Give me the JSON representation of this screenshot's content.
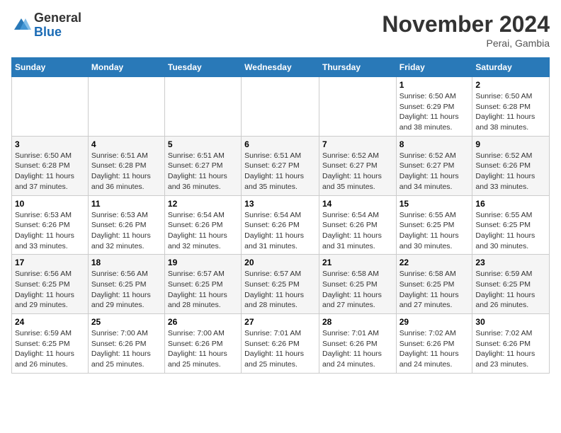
{
  "logo": {
    "general": "General",
    "blue": "Blue"
  },
  "title": "November 2024",
  "location": "Perai, Gambia",
  "days_of_week": [
    "Sunday",
    "Monday",
    "Tuesday",
    "Wednesday",
    "Thursday",
    "Friday",
    "Saturday"
  ],
  "weeks": [
    [
      {
        "day": "",
        "info": ""
      },
      {
        "day": "",
        "info": ""
      },
      {
        "day": "",
        "info": ""
      },
      {
        "day": "",
        "info": ""
      },
      {
        "day": "",
        "info": ""
      },
      {
        "day": "1",
        "info": "Sunrise: 6:50 AM\nSunset: 6:29 PM\nDaylight: 11 hours and 38 minutes."
      },
      {
        "day": "2",
        "info": "Sunrise: 6:50 AM\nSunset: 6:28 PM\nDaylight: 11 hours and 38 minutes."
      }
    ],
    [
      {
        "day": "3",
        "info": "Sunrise: 6:50 AM\nSunset: 6:28 PM\nDaylight: 11 hours and 37 minutes."
      },
      {
        "day": "4",
        "info": "Sunrise: 6:51 AM\nSunset: 6:28 PM\nDaylight: 11 hours and 36 minutes."
      },
      {
        "day": "5",
        "info": "Sunrise: 6:51 AM\nSunset: 6:27 PM\nDaylight: 11 hours and 36 minutes."
      },
      {
        "day": "6",
        "info": "Sunrise: 6:51 AM\nSunset: 6:27 PM\nDaylight: 11 hours and 35 minutes."
      },
      {
        "day": "7",
        "info": "Sunrise: 6:52 AM\nSunset: 6:27 PM\nDaylight: 11 hours and 35 minutes."
      },
      {
        "day": "8",
        "info": "Sunrise: 6:52 AM\nSunset: 6:27 PM\nDaylight: 11 hours and 34 minutes."
      },
      {
        "day": "9",
        "info": "Sunrise: 6:52 AM\nSunset: 6:26 PM\nDaylight: 11 hours and 33 minutes."
      }
    ],
    [
      {
        "day": "10",
        "info": "Sunrise: 6:53 AM\nSunset: 6:26 PM\nDaylight: 11 hours and 33 minutes."
      },
      {
        "day": "11",
        "info": "Sunrise: 6:53 AM\nSunset: 6:26 PM\nDaylight: 11 hours and 32 minutes."
      },
      {
        "day": "12",
        "info": "Sunrise: 6:54 AM\nSunset: 6:26 PM\nDaylight: 11 hours and 32 minutes."
      },
      {
        "day": "13",
        "info": "Sunrise: 6:54 AM\nSunset: 6:26 PM\nDaylight: 11 hours and 31 minutes."
      },
      {
        "day": "14",
        "info": "Sunrise: 6:54 AM\nSunset: 6:26 PM\nDaylight: 11 hours and 31 minutes."
      },
      {
        "day": "15",
        "info": "Sunrise: 6:55 AM\nSunset: 6:25 PM\nDaylight: 11 hours and 30 minutes."
      },
      {
        "day": "16",
        "info": "Sunrise: 6:55 AM\nSunset: 6:25 PM\nDaylight: 11 hours and 30 minutes."
      }
    ],
    [
      {
        "day": "17",
        "info": "Sunrise: 6:56 AM\nSunset: 6:25 PM\nDaylight: 11 hours and 29 minutes."
      },
      {
        "day": "18",
        "info": "Sunrise: 6:56 AM\nSunset: 6:25 PM\nDaylight: 11 hours and 29 minutes."
      },
      {
        "day": "19",
        "info": "Sunrise: 6:57 AM\nSunset: 6:25 PM\nDaylight: 11 hours and 28 minutes."
      },
      {
        "day": "20",
        "info": "Sunrise: 6:57 AM\nSunset: 6:25 PM\nDaylight: 11 hours and 28 minutes."
      },
      {
        "day": "21",
        "info": "Sunrise: 6:58 AM\nSunset: 6:25 PM\nDaylight: 11 hours and 27 minutes."
      },
      {
        "day": "22",
        "info": "Sunrise: 6:58 AM\nSunset: 6:25 PM\nDaylight: 11 hours and 27 minutes."
      },
      {
        "day": "23",
        "info": "Sunrise: 6:59 AM\nSunset: 6:25 PM\nDaylight: 11 hours and 26 minutes."
      }
    ],
    [
      {
        "day": "24",
        "info": "Sunrise: 6:59 AM\nSunset: 6:25 PM\nDaylight: 11 hours and 26 minutes."
      },
      {
        "day": "25",
        "info": "Sunrise: 7:00 AM\nSunset: 6:26 PM\nDaylight: 11 hours and 25 minutes."
      },
      {
        "day": "26",
        "info": "Sunrise: 7:00 AM\nSunset: 6:26 PM\nDaylight: 11 hours and 25 minutes."
      },
      {
        "day": "27",
        "info": "Sunrise: 7:01 AM\nSunset: 6:26 PM\nDaylight: 11 hours and 25 minutes."
      },
      {
        "day": "28",
        "info": "Sunrise: 7:01 AM\nSunset: 6:26 PM\nDaylight: 11 hours and 24 minutes."
      },
      {
        "day": "29",
        "info": "Sunrise: 7:02 AM\nSunset: 6:26 PM\nDaylight: 11 hours and 24 minutes."
      },
      {
        "day": "30",
        "info": "Sunrise: 7:02 AM\nSunset: 6:26 PM\nDaylight: 11 hours and 23 minutes."
      }
    ]
  ]
}
